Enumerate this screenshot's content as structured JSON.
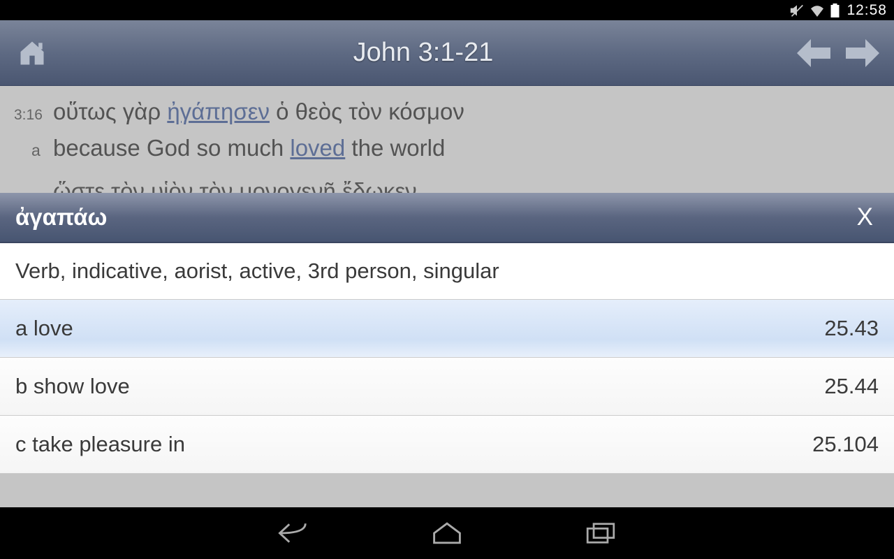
{
  "status_bar": {
    "time": "12:58"
  },
  "header": {
    "title": "John 3:1-21"
  },
  "scripture": {
    "verse_ref": "3:16",
    "greek_prefix": "οὕτως γὰρ ",
    "greek_linked": "ἠγάπησεν",
    "greek_suffix": " ὁ θεὸς τὸν κόσμον",
    "trans_label": "a",
    "trans_prefix": "because God so much ",
    "trans_linked": "loved",
    "trans_suffix": " the world",
    "next_line": "ὥστε τὸν υἱὸν τὸν μονογενῆ ἔδωκεν"
  },
  "lexicon": {
    "word": "ἀγαπάω",
    "parsing": "Verb, indicative, aorist, active, 3rd person, singular",
    "close_label": "X",
    "definitions": [
      {
        "label": "a love",
        "reference": "25.43",
        "selected": true
      },
      {
        "label": "b show love",
        "reference": "25.44",
        "selected": false
      },
      {
        "label": "c take pleasure in",
        "reference": "25.104",
        "selected": false
      }
    ]
  }
}
